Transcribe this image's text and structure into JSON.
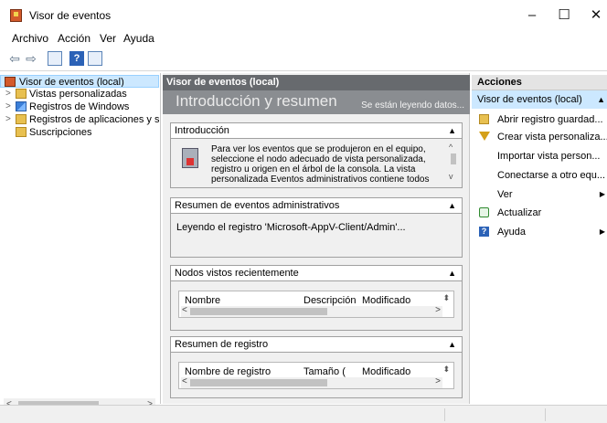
{
  "window": {
    "title": "Visor de eventos",
    "controls": {
      "minimize": "–",
      "maximize": "☐",
      "close": "✕"
    }
  },
  "menu": {
    "items": [
      "Archivo",
      "Acción",
      "Ver",
      "Ayuda"
    ]
  },
  "toolbar": {
    "back_icon": "arrow-left-icon",
    "forward_icon": "arrow-right-icon",
    "help_glyph": "?"
  },
  "tree": {
    "items": [
      {
        "label": "Visor de eventos (local)",
        "icon": "event-viewer-icon",
        "selected": true,
        "expander": ""
      },
      {
        "label": "Vistas personalizadas",
        "icon": "folder-icon",
        "selected": false,
        "expander": ">"
      },
      {
        "label": "Registros de Windows",
        "icon": "windows-logs-icon",
        "selected": false,
        "expander": ">"
      },
      {
        "label": "Registros de aplicaciones y s",
        "icon": "folder-icon",
        "selected": false,
        "expander": ">"
      },
      {
        "label": "Suscripciones",
        "icon": "subscriptions-icon",
        "selected": false,
        "expander": ""
      }
    ],
    "scroll_left": "<",
    "scroll_right": ">"
  },
  "center": {
    "header": "Visor de eventos (local)",
    "banner_title": "Introducción y resumen",
    "banner_status": "Se están leyendo datos...",
    "sections": {
      "intro": {
        "title": "Introducción",
        "text": "Para ver los eventos que se produjeron en el equipo, seleccione el nodo adecuado de vista personalizada, registro u origen en el árbol de la consola. La vista personalizada Eventos administrativos contiene todos"
      },
      "admin": {
        "title": "Resumen de eventos administrativos",
        "text": "Leyendo el registro 'Microsoft-AppV-Client/Admin'..."
      },
      "recent": {
        "title": "Nodos vistos recientemente",
        "columns": [
          "Nombre",
          "Descripción",
          "Modificado"
        ]
      },
      "log": {
        "title": "Resumen de registro",
        "columns": [
          "Nombre de registro",
          "Tamaño (",
          "Modificado"
        ]
      }
    }
  },
  "actions": {
    "header": "Acciones",
    "group": "Visor de eventos (local)",
    "items": [
      {
        "label": "Abrir registro guardad...",
        "icon": "open-folder-icon",
        "submenu": false
      },
      {
        "label": "Crear vista personaliza...",
        "icon": "filter-icon",
        "submenu": false
      },
      {
        "label": "Importar vista person...",
        "icon": "",
        "submenu": false
      },
      {
        "label": "Conectarse a otro equ...",
        "icon": "",
        "submenu": false
      },
      {
        "label": "Ver",
        "icon": "",
        "submenu": true
      },
      {
        "label": "Actualizar",
        "icon": "refresh-icon",
        "submenu": false
      },
      {
        "label": "Ayuda",
        "icon": "help-icon",
        "submenu": true
      }
    ]
  }
}
